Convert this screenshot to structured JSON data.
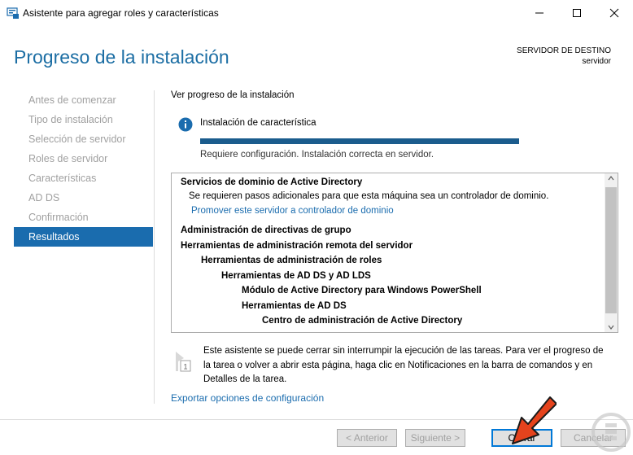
{
  "window": {
    "title": "Asistente para agregar roles y características",
    "icon": "server-manager-icon"
  },
  "header": {
    "title": "Progreso de la instalación",
    "destination_label": "SERVIDOR DE DESTINO",
    "destination_server": "servidor"
  },
  "nav": {
    "items": [
      {
        "label": "Antes de comenzar",
        "active": false
      },
      {
        "label": "Tipo de instalación",
        "active": false
      },
      {
        "label": "Selección de servidor",
        "active": false
      },
      {
        "label": "Roles de servidor",
        "active": false
      },
      {
        "label": "Características",
        "active": false
      },
      {
        "label": "AD DS",
        "active": false
      },
      {
        "label": "Confirmación",
        "active": false
      },
      {
        "label": "Resultados",
        "active": true
      }
    ]
  },
  "main": {
    "section_label": "Ver progreso de la instalación",
    "status_title": "Instalación de característica",
    "progress": 1.0,
    "status_message": "Requiere configuración. Instalación correcta en servidor.",
    "results": [
      {
        "text": "Servicios de dominio de Active Directory",
        "bold": true
      },
      {
        "text": "Se requieren pasos adicionales para que esta máquina sea un controlador de dominio.",
        "bold": false
      },
      {
        "text": "Promover este servidor a controlador de dominio",
        "link": true
      },
      {
        "text": "Administración de directivas de grupo",
        "bold": true
      },
      {
        "text": "Herramientas de administración remota del servidor",
        "bold": true
      },
      {
        "text": "Herramientas de administración de roles",
        "bold": true
      },
      {
        "text": "Herramientas de AD DS y AD LDS",
        "bold": true
      },
      {
        "text": "Módulo de Active Directory para Windows PowerShell",
        "bold": true
      },
      {
        "text": "Herramientas de AD DS",
        "bold": true
      },
      {
        "text": "Centro de administración de Active Directory",
        "bold": true
      }
    ],
    "note": "Este asistente se puede cerrar sin interrumpir la ejecución de las tareas. Para ver el progreso de la tarea o volver a abrir esta página, haga clic en Notificaciones en la barra de comandos y en Detalles de la tarea.",
    "export_link": "Exportar opciones de configuración"
  },
  "footer": {
    "previous": "< Anterior",
    "next": "Siguiente >",
    "close": "Cerrar",
    "cancel": "Cancelar"
  },
  "colors": {
    "accent": "#1a6cae",
    "header_title": "#1c6ea4",
    "progress_fill": "#1b5c8d",
    "arrow": "#e5431d"
  }
}
